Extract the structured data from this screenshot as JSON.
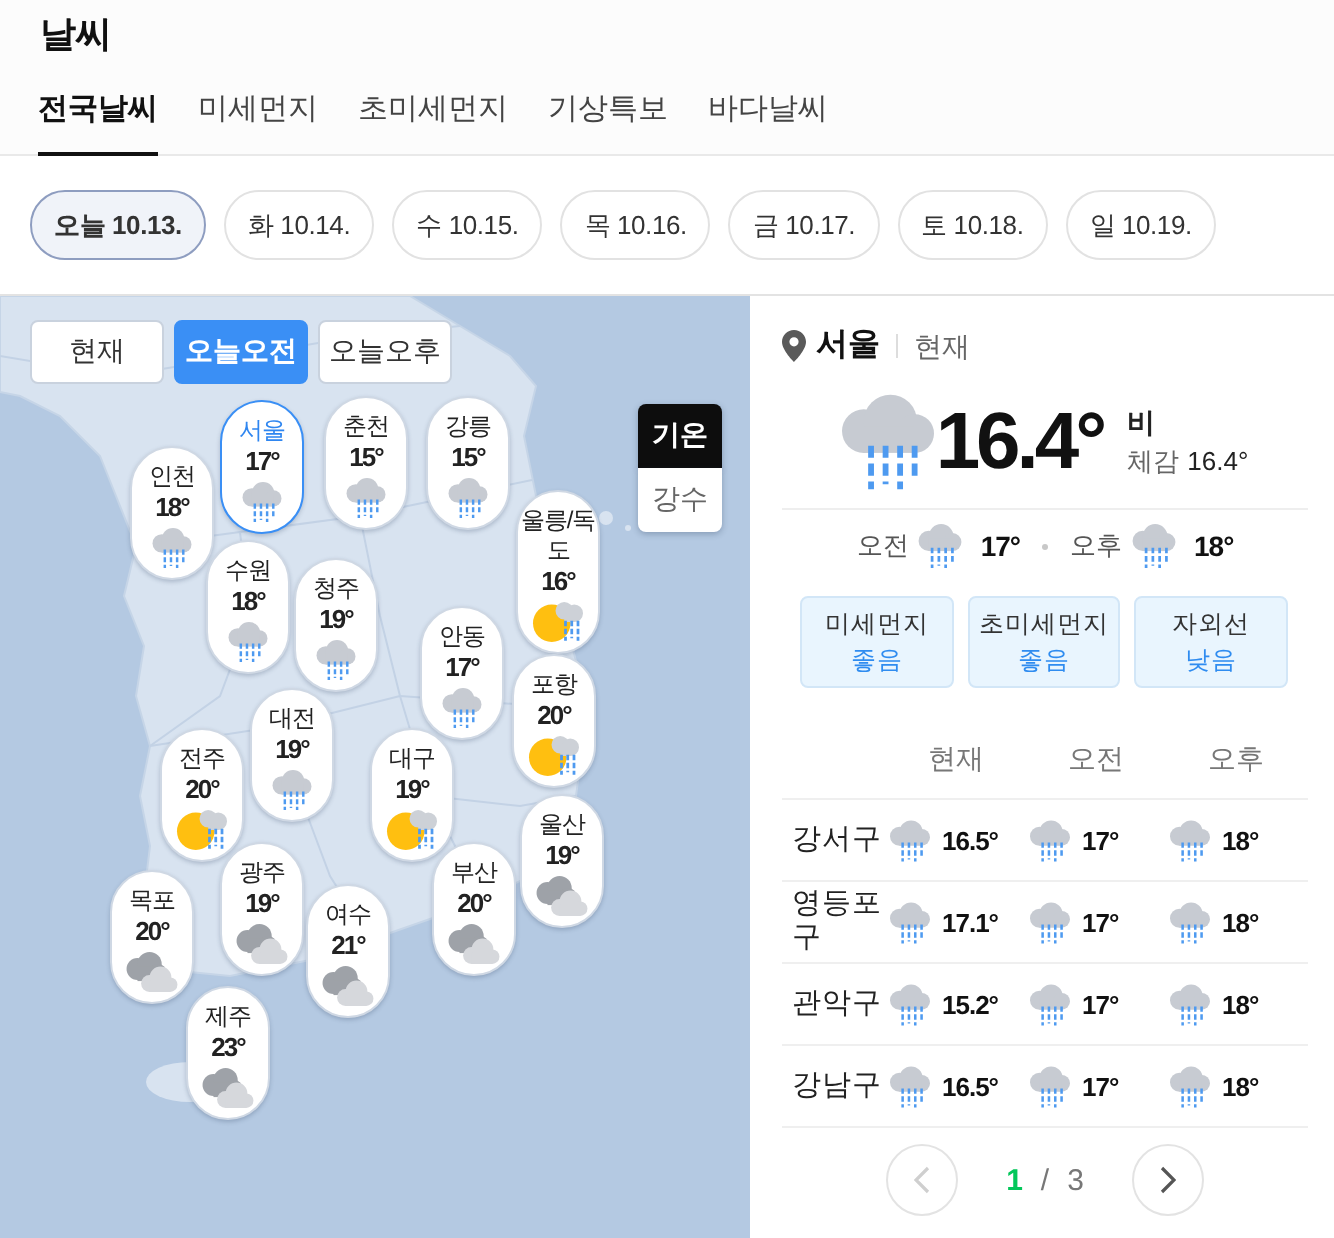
{
  "app": {
    "title": "날씨"
  },
  "tabs": [
    {
      "label": "전국날씨",
      "selected": true
    },
    {
      "label": "미세먼지",
      "selected": false
    },
    {
      "label": "초미세먼지",
      "selected": false
    },
    {
      "label": "기상특보",
      "selected": false
    },
    {
      "label": "바다날씨",
      "selected": false
    }
  ],
  "dates": [
    {
      "label": "오늘 10.13.",
      "selected": true
    },
    {
      "label": "화 10.14.",
      "selected": false
    },
    {
      "label": "수 10.15.",
      "selected": false
    },
    {
      "label": "목 10.16.",
      "selected": false
    },
    {
      "label": "금 10.17.",
      "selected": false
    },
    {
      "label": "토 10.18.",
      "selected": false
    },
    {
      "label": "일 10.19.",
      "selected": false
    }
  ],
  "map": {
    "period_toggle": [
      {
        "label": "현재",
        "selected": false
      },
      {
        "label": "오늘오전",
        "selected": true
      },
      {
        "label": "오늘오후",
        "selected": false
      }
    ],
    "layer_toggle": [
      {
        "label": "기온",
        "selected": true
      },
      {
        "label": "강수",
        "selected": false
      }
    ],
    "cities": [
      {
        "name": "서울",
        "temp": "17°",
        "kind": "rain",
        "selected": true
      },
      {
        "name": "춘천",
        "temp": "15°",
        "kind": "rain",
        "selected": false
      },
      {
        "name": "강릉",
        "temp": "15°",
        "kind": "rain",
        "selected": false
      },
      {
        "name": "인천",
        "temp": "18°",
        "kind": "rain",
        "selected": false
      },
      {
        "name": "울릉/독도",
        "temp": "16°",
        "kind": "partly-rain",
        "selected": false
      },
      {
        "name": "수원",
        "temp": "18°",
        "kind": "rain",
        "selected": false
      },
      {
        "name": "청주",
        "temp": "19°",
        "kind": "rain",
        "selected": false
      },
      {
        "name": "안동",
        "temp": "17°",
        "kind": "rain",
        "selected": false
      },
      {
        "name": "포항",
        "temp": "20°",
        "kind": "partly-rain",
        "selected": false
      },
      {
        "name": "대전",
        "temp": "19°",
        "kind": "rain",
        "selected": false
      },
      {
        "name": "전주",
        "temp": "20°",
        "kind": "partly-rain",
        "selected": false
      },
      {
        "name": "대구",
        "temp": "19°",
        "kind": "partly-rain",
        "selected": false
      },
      {
        "name": "울산",
        "temp": "19°",
        "kind": "cloudy",
        "selected": false
      },
      {
        "name": "광주",
        "temp": "19°",
        "kind": "cloudy",
        "selected": false
      },
      {
        "name": "부산",
        "temp": "20°",
        "kind": "cloudy",
        "selected": false
      },
      {
        "name": "목포",
        "temp": "20°",
        "kind": "cloudy",
        "selected": false
      },
      {
        "name": "여수",
        "temp": "21°",
        "kind": "cloudy",
        "selected": false
      },
      {
        "name": "제주",
        "temp": "23°",
        "kind": "cloudy",
        "selected": false
      }
    ]
  },
  "detail": {
    "location": "서울",
    "time_label": "현재",
    "kind": "rain",
    "temperature": "16.4°",
    "condition": "비",
    "feels_label": "체감",
    "feels_value": "16.4°",
    "forecast": [
      {
        "label": "오전",
        "kind": "rain",
        "temp": "17°"
      },
      {
        "label": "오후",
        "kind": "rain",
        "temp": "18°"
      }
    ],
    "air": [
      {
        "label": "미세먼지",
        "value": "좋음"
      },
      {
        "label": "초미세먼지",
        "value": "좋음"
      },
      {
        "label": "자외선",
        "value": "낮음"
      }
    ]
  },
  "district_table": {
    "columns": [
      "현재",
      "오전",
      "오후"
    ],
    "rows": [
      {
        "name": "강서구",
        "cells": [
          {
            "kind": "rain",
            "temp": "16.5°"
          },
          {
            "kind": "rain",
            "temp": "17°"
          },
          {
            "kind": "rain",
            "temp": "18°"
          }
        ]
      },
      {
        "name": "영등포구",
        "cells": [
          {
            "kind": "rain",
            "temp": "17.1°"
          },
          {
            "kind": "rain",
            "temp": "17°"
          },
          {
            "kind": "rain",
            "temp": "18°"
          }
        ]
      },
      {
        "name": "관악구",
        "cells": [
          {
            "kind": "rain",
            "temp": "15.2°"
          },
          {
            "kind": "rain",
            "temp": "17°"
          },
          {
            "kind": "rain",
            "temp": "18°"
          }
        ]
      },
      {
        "name": "강남구",
        "cells": [
          {
            "kind": "rain",
            "temp": "16.5°"
          },
          {
            "kind": "rain",
            "temp": "17°"
          },
          {
            "kind": "rain",
            "temp": "18°"
          }
        ]
      }
    ]
  },
  "pagination": {
    "current": "1",
    "separator": "/",
    "total": "3",
    "prev_disabled": true
  }
}
